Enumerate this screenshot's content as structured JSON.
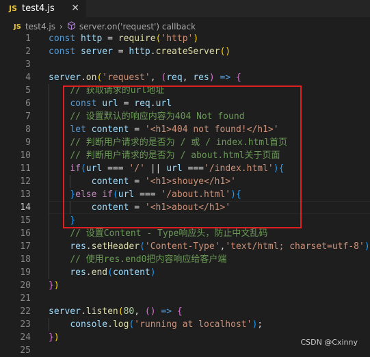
{
  "tab": {
    "badge": "JS",
    "filename": "test4.js",
    "close": "✕"
  },
  "breadcrumb": {
    "badge": "JS",
    "file": "test4.js",
    "symbol": "server.on('request') callback"
  },
  "lines": [
    {
      "n": "1",
      "tokens": [
        [
          "kw",
          "const "
        ],
        [
          "var",
          "http"
        ],
        [
          "pun",
          " = "
        ],
        [
          "fn",
          "require"
        ],
        [
          "br1",
          "("
        ],
        [
          "str",
          "'http'"
        ],
        [
          "br1",
          ")"
        ]
      ]
    },
    {
      "n": "2",
      "tokens": [
        [
          "kw",
          "const "
        ],
        [
          "var",
          "server"
        ],
        [
          "pun",
          " = "
        ],
        [
          "var",
          "http"
        ],
        [
          "pun",
          "."
        ],
        [
          "fn",
          "createServer"
        ],
        [
          "br1",
          "()"
        ]
      ]
    },
    {
      "n": "3",
      "tokens": []
    },
    {
      "n": "4",
      "tokens": [
        [
          "var",
          "server"
        ],
        [
          "pun",
          "."
        ],
        [
          "fn",
          "on"
        ],
        [
          "br1",
          "("
        ],
        [
          "str",
          "'request'"
        ],
        [
          "pun",
          ", "
        ],
        [
          "br2",
          "("
        ],
        [
          "var",
          "req"
        ],
        [
          "pun",
          ", "
        ],
        [
          "var",
          "res"
        ],
        [
          "br2",
          ")"
        ],
        [
          "kw",
          " => "
        ],
        [
          "br2",
          "{"
        ]
      ]
    },
    {
      "n": "5",
      "tokens": [
        [
          "pun",
          "    "
        ],
        [
          "cm",
          "// 获取请求的url地址"
        ]
      ]
    },
    {
      "n": "6",
      "tokens": [
        [
          "pun",
          "    "
        ],
        [
          "kw",
          "const "
        ],
        [
          "var",
          "url"
        ],
        [
          "pun",
          " = "
        ],
        [
          "var",
          "req"
        ],
        [
          "pun",
          "."
        ],
        [
          "var",
          "url"
        ]
      ]
    },
    {
      "n": "7",
      "tokens": [
        [
          "pun",
          "    "
        ],
        [
          "cm",
          "// 设置默认的响应内容为404 Not found"
        ]
      ]
    },
    {
      "n": "8",
      "tokens": [
        [
          "pun",
          "    "
        ],
        [
          "kw",
          "let "
        ],
        [
          "var",
          "content"
        ],
        [
          "pun",
          " = "
        ],
        [
          "str",
          "'<h1>404 not found!</h1>'"
        ]
      ]
    },
    {
      "n": "9",
      "tokens": [
        [
          "pun",
          "    "
        ],
        [
          "cm",
          "// 判断用户请求的是否为 / 或 / index.html首页"
        ]
      ]
    },
    {
      "n": "10",
      "tokens": [
        [
          "pun",
          "    "
        ],
        [
          "cm",
          "// 判断用户请求的是否为 / about.html关于页面"
        ]
      ]
    },
    {
      "n": "11",
      "tokens": [
        [
          "pun",
          "    "
        ],
        [
          "kwc",
          "if"
        ],
        [
          "br3",
          "("
        ],
        [
          "var",
          "url"
        ],
        [
          "pun",
          " === "
        ],
        [
          "str",
          "'/'"
        ],
        [
          "pun",
          " || "
        ],
        [
          "var",
          "url"
        ],
        [
          "pun",
          " ==="
        ],
        [
          "str",
          "'/index.html'"
        ],
        [
          "br3",
          ")"
        ],
        [
          "br3",
          "{"
        ]
      ]
    },
    {
      "n": "12",
      "tokens": [
        [
          "pun",
          "        "
        ],
        [
          "var",
          "content"
        ],
        [
          "pun",
          " = "
        ],
        [
          "str",
          "'<h1>shouye</h1>'"
        ]
      ]
    },
    {
      "n": "13",
      "tokens": [
        [
          "pun",
          "    "
        ],
        [
          "br3",
          "}"
        ],
        [
          "kwc",
          "else if"
        ],
        [
          "br3",
          "("
        ],
        [
          "var",
          "url"
        ],
        [
          "pun",
          " === "
        ],
        [
          "str",
          "'/about.html'"
        ],
        [
          "br3",
          ")"
        ],
        [
          "br3",
          "{"
        ]
      ]
    },
    {
      "n": "14",
      "tokens": [
        [
          "pun",
          "        "
        ],
        [
          "var",
          "content"
        ],
        [
          "pun",
          " = "
        ],
        [
          "str",
          "'<h1>about</h1>'"
        ]
      ]
    },
    {
      "n": "15",
      "tokens": [
        [
          "pun",
          "    "
        ],
        [
          "br3",
          "}"
        ]
      ]
    },
    {
      "n": "16",
      "tokens": [
        [
          "pun",
          "    "
        ],
        [
          "cm",
          "// 设置Content - Type响应头，防止中文乱码"
        ]
      ]
    },
    {
      "n": "17",
      "tokens": [
        [
          "pun",
          "    "
        ],
        [
          "var",
          "res"
        ],
        [
          "pun",
          "."
        ],
        [
          "fn",
          "setHeader"
        ],
        [
          "br3",
          "("
        ],
        [
          "str",
          "'Content-Type'"
        ],
        [
          "pun",
          ","
        ],
        [
          "str",
          "'text/html; charset=utf-8'"
        ],
        [
          "br3",
          ")"
        ]
      ]
    },
    {
      "n": "18",
      "tokens": [
        [
          "pun",
          "    "
        ],
        [
          "cm",
          "// 使用res.end0把内容响应给客户端"
        ]
      ]
    },
    {
      "n": "19",
      "tokens": [
        [
          "pun",
          "    "
        ],
        [
          "var",
          "res"
        ],
        [
          "pun",
          "."
        ],
        [
          "fn",
          "end"
        ],
        [
          "br3",
          "("
        ],
        [
          "var",
          "content"
        ],
        [
          "br3",
          ")"
        ]
      ]
    },
    {
      "n": "20",
      "tokens": [
        [
          "br2",
          "}"
        ],
        [
          "br1",
          ")"
        ]
      ]
    },
    {
      "n": "21",
      "tokens": []
    },
    {
      "n": "22",
      "tokens": [
        [
          "var",
          "server"
        ],
        [
          "pun",
          "."
        ],
        [
          "fn",
          "listen"
        ],
        [
          "br1",
          "("
        ],
        [
          "num",
          "80"
        ],
        [
          "pun",
          ", "
        ],
        [
          "br2",
          "()"
        ],
        [
          "kw",
          " => "
        ],
        [
          "br2",
          "{"
        ]
      ]
    },
    {
      "n": "23",
      "tokens": [
        [
          "pun",
          "    "
        ],
        [
          "var",
          "console"
        ],
        [
          "pun",
          "."
        ],
        [
          "fn",
          "log"
        ],
        [
          "br3",
          "("
        ],
        [
          "str",
          "'running at localhost'"
        ],
        [
          "br3",
          ")"
        ],
        [
          "pun",
          ";"
        ]
      ]
    },
    {
      "n": "24",
      "tokens": [
        [
          "br2",
          "}"
        ],
        [
          "br1",
          ")"
        ]
      ]
    },
    {
      "n": "25",
      "tokens": []
    }
  ],
  "active_line": "14",
  "watermark": "CSDN @Cxinny"
}
